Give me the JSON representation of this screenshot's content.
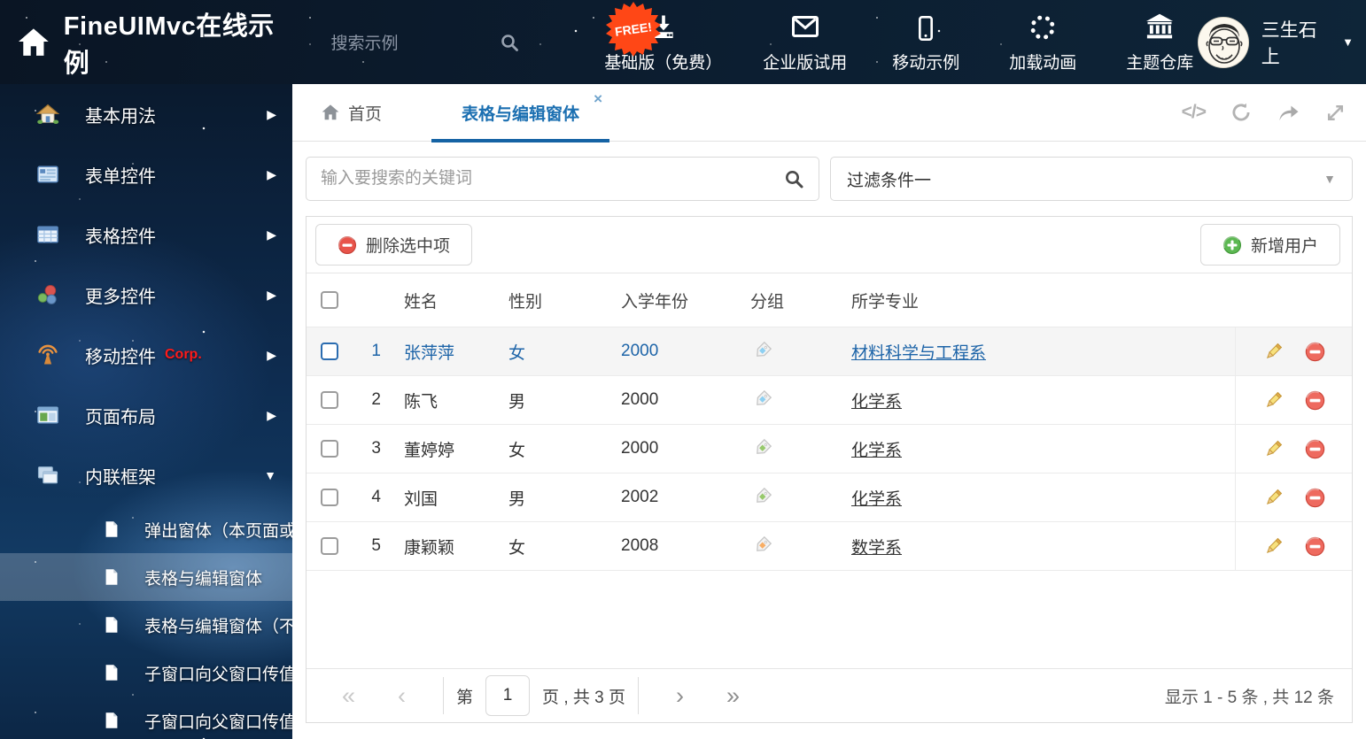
{
  "header": {
    "title": "FineUIMvc在线示例",
    "search_placeholder": "搜索示例",
    "free_badge": "FREE!",
    "free_badge_color": "#ff4716",
    "nav": [
      {
        "icon": "download-icon",
        "label": "基础版（免费）"
      },
      {
        "icon": "mail-icon",
        "label": "企业版试用"
      },
      {
        "icon": "phone-icon",
        "label": "移动示例"
      },
      {
        "icon": "spinner-icon",
        "label": "加载动画"
      },
      {
        "icon": "bank-icon",
        "label": "主题仓库"
      }
    ],
    "user": "三生石上"
  },
  "sidebar": {
    "items": [
      {
        "icon": "house-icon",
        "label": "基本用法"
      },
      {
        "icon": "form-icon",
        "label": "表单控件"
      },
      {
        "icon": "grid-icon",
        "label": "表格控件"
      },
      {
        "icon": "cubes-icon",
        "label": "更多控件"
      },
      {
        "icon": "antenna-icon",
        "label": "移动控件",
        "badge": "Corp."
      },
      {
        "icon": "layout-icon",
        "label": "页面布局"
      },
      {
        "icon": "frames-icon",
        "label": "内联框架",
        "expanded": true
      }
    ],
    "subitems": [
      {
        "label": "弹出窗体（本页面或...",
        "active": false
      },
      {
        "label": "表格与编辑窗体",
        "active": true
      },
      {
        "label": "表格与编辑窗体（不...",
        "active": false
      },
      {
        "label": "子窗口向父窗口传值",
        "active": false
      },
      {
        "label": "子窗口向父窗口传值...",
        "active": false
      }
    ]
  },
  "tabs": {
    "home_label": "首页",
    "active_label": "表格与编辑窗体",
    "close_glyph": "×",
    "accent_color": "#1b6fb1"
  },
  "filters": {
    "search_placeholder": "输入要搜索的关键词",
    "filter_value": "过滤条件一"
  },
  "toolbar": {
    "delete_label": "删除选中项",
    "add_label": "新增用户"
  },
  "table": {
    "headers": {
      "name": "姓名",
      "gender": "性别",
      "year": "入学年份",
      "group": "分组",
      "major": "所学专业"
    },
    "rows": [
      {
        "num": "1",
        "name": "张萍萍",
        "gender": "女",
        "year": "2000",
        "tag_color": "#8ed0f2",
        "major": "材料科学与工程系",
        "selected": true
      },
      {
        "num": "2",
        "name": "陈飞",
        "gender": "男",
        "year": "2000",
        "tag_color": "#8ed0f2",
        "major": "化学系",
        "selected": false
      },
      {
        "num": "3",
        "name": "董婷婷",
        "gender": "女",
        "year": "2000",
        "tag_color": "#97c96c",
        "major": "化学系",
        "selected": false
      },
      {
        "num": "4",
        "name": "刘国",
        "gender": "男",
        "year": "2002",
        "tag_color": "#97c96c",
        "major": "化学系",
        "selected": false
      },
      {
        "num": "5",
        "name": "康颖颖",
        "gender": "女",
        "year": "2008",
        "tag_color": "#f8ae65",
        "major": "数学系",
        "selected": false
      }
    ]
  },
  "pagination": {
    "first_glyph": "«",
    "prev_glyph": "‹",
    "next_glyph": "›",
    "last_glyph": "»",
    "page_prefix": "第",
    "page": "1",
    "page_suffix": "页 , 共 3 页",
    "summary": "显示 1 - 5 条 , 共 12 条"
  }
}
